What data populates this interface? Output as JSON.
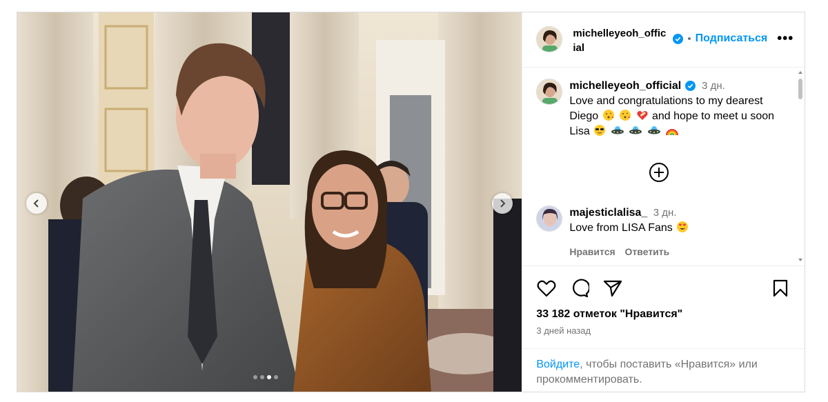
{
  "post": {
    "username_header": "michelleyeoh_official",
    "follow_label": "Подписаться",
    "more_label": "•••"
  },
  "caption": {
    "username": "michelleyeoh_official",
    "time": "3 дн.",
    "text_part1": "Love and congratulations to my dearest Diego",
    "text_part2": "and hope to meet u soon Lisa"
  },
  "comment": {
    "username": "majesticlalisa_",
    "time": "3 дн.",
    "text": "Love from LISA Fans",
    "like_label": "Нравится",
    "reply_label": "Ответить"
  },
  "footer": {
    "likes": "33 182 отметок \"Нравится\"",
    "date": "3 дней назад",
    "login_link": "Войдите",
    "login_rest": ", чтобы поставить «Нравится» или прокомментировать."
  },
  "carousel": {
    "slide_count": 4,
    "active_index": 2
  },
  "icons": [
    "verified-badge-icon",
    "add-comment-icon",
    "heart-icon",
    "comment-icon",
    "share-icon",
    "bookmark-icon",
    "chevron-left-icon",
    "chevron-right-icon"
  ],
  "colors": {
    "link": "#0095f6",
    "secondary_text": "#737373",
    "border": "#dbdbdb"
  }
}
